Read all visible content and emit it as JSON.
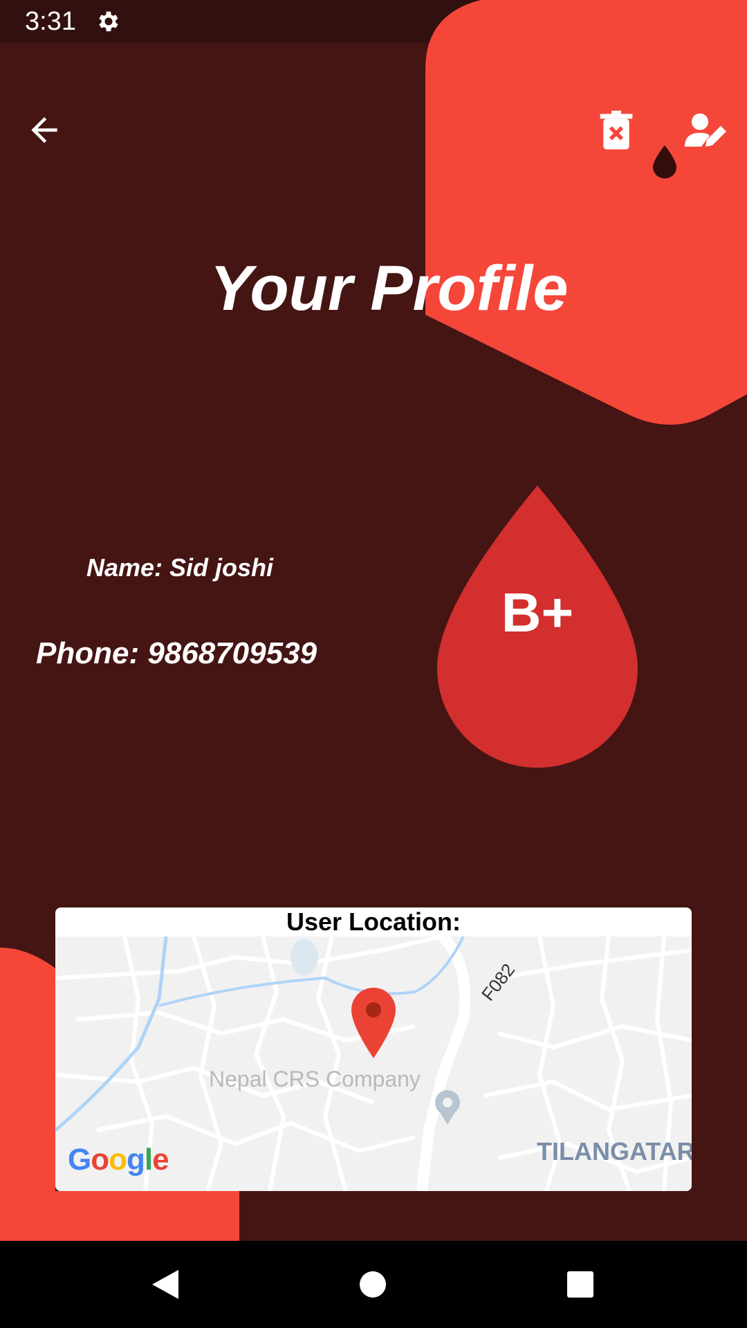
{
  "status": {
    "time": "3:31",
    "icons": [
      "gear-icon",
      "wifi-icon",
      "signal-icon",
      "battery-icon"
    ]
  },
  "header": {
    "title": "Your Profile",
    "icons": [
      "back-arrow-icon",
      "delete-icon",
      "edit-person-icon",
      "blood-drop-icon"
    ]
  },
  "profile": {
    "name": "Name: Sid joshi",
    "phone": "Phone: 9868709539",
    "blood_type": "B+"
  },
  "map": {
    "label": "User Location:",
    "place": "Nepal CRS Company",
    "road": "F082",
    "area": "TILANGATAR",
    "logo": "Google"
  },
  "colors": {
    "background": "#441513",
    "accent": "#f4473a",
    "drop": "#d32f2f",
    "status_bar": "#331010"
  },
  "nav": [
    "back-triangle-icon",
    "home-circle-icon",
    "recents-square-icon"
  ]
}
